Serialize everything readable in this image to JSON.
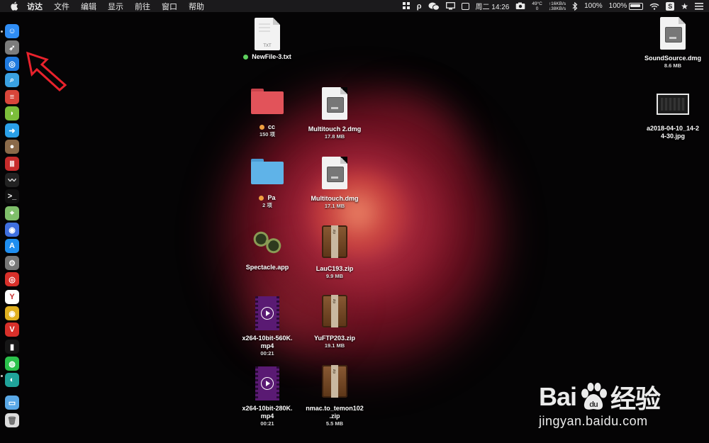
{
  "menubar": {
    "app_name": "访达",
    "menus": [
      "文件",
      "编辑",
      "显示",
      "前往",
      "窗口",
      "帮助"
    ],
    "clock": "周二 14:26",
    "temperature": "49°C",
    "fan": "0",
    "net_up": "↑16KB/s",
    "net_down": "↓38KB/s",
    "volume_percent": "100%",
    "battery_percent": "100%"
  },
  "dock": {
    "items": [
      {
        "name": "finder",
        "color": "#2f8df5",
        "glyph": "☺"
      },
      {
        "name": "launchpad",
        "color": "#7c7c7c",
        "glyph": "➶"
      },
      {
        "name": "safari",
        "color": "#1f7ae0",
        "glyph": "◎"
      },
      {
        "name": "preview",
        "color": "#3aa1e2",
        "glyph": "⌕"
      },
      {
        "name": "app-red",
        "color": "#d9453a",
        "glyph": "≡"
      },
      {
        "name": "android",
        "color": "#7cbe3a",
        "glyph": "◗"
      },
      {
        "name": "migration",
        "color": "#2aa0e8",
        "glyph": "➜"
      },
      {
        "name": "shell",
        "color": "#8a6a4a",
        "glyph": "●"
      },
      {
        "name": "app-bars",
        "color": "#c62b2b",
        "glyph": "Ⅲ"
      },
      {
        "name": "activity-monitor",
        "color": "#222222",
        "glyph": "〰"
      },
      {
        "name": "terminal",
        "color": "#111111",
        "glyph": ">_"
      },
      {
        "name": "maps",
        "color": "#7fbf6a",
        "glyph": "⌖"
      },
      {
        "name": "siri",
        "color": "#3f6fe0",
        "glyph": "◉"
      },
      {
        "name": "app-store",
        "color": "#1f8ef0",
        "glyph": "A"
      },
      {
        "name": "system-preferences",
        "color": "#777777",
        "glyph": "⚙"
      },
      {
        "name": "netease-music",
        "color": "#d8302a",
        "glyph": "◎"
      },
      {
        "name": "yandex",
        "color": "#ffffff",
        "glyph": "Y"
      },
      {
        "name": "chrome",
        "color": "#e0b020",
        "glyph": "◉"
      },
      {
        "name": "vivaldi",
        "color": "#d8302a",
        "glyph": "V"
      },
      {
        "name": "terminal-2",
        "color": "#161616",
        "glyph": "▮"
      },
      {
        "name": "wechat",
        "color": "#2bc14b",
        "glyph": "◍"
      },
      {
        "name": "app-teal",
        "color": "#20a39a",
        "glyph": "◐"
      },
      {
        "name": "downloads-folder",
        "color": "#5aa8e6",
        "glyph": "▭"
      },
      {
        "name": "trash",
        "color": "#dcdcdc",
        "glyph": "🗑"
      }
    ]
  },
  "desktop": {
    "newfile": {
      "name": "NewFile-3.txt",
      "ext": "TXT",
      "tag_color": "#5ed05e"
    },
    "cc_folder": {
      "name": "cc",
      "count": "150 项",
      "tag_color": "#f0a040",
      "color": "#e2535a"
    },
    "pa_folder": {
      "name": "Pa",
      "count": "2 项",
      "tag_color": "#f0a040",
      "color": "#5fb3e8"
    },
    "multitouch2": {
      "name": "Multitouch 2.dmg",
      "size": "17.8 MB"
    },
    "multitouch": {
      "name": "Multitouch.dmg",
      "size": "17.1 MB"
    },
    "spectacle": {
      "name": "Spectacle.app"
    },
    "lauc": {
      "name": "LauC193.zip",
      "size": "9.9 MB"
    },
    "yuftp": {
      "name": "YuFTP203.zip",
      "size": "19.1 MB"
    },
    "nmac": {
      "name_line1": "nmac.to_temon102",
      "name_line2": ".zip",
      "size": "5.5 MB"
    },
    "video560": {
      "name_line1": "x264-10bit-560K.",
      "name_line2": "mp4",
      "duration": "00:21"
    },
    "video280": {
      "name_line1": "x264-10bit-280K.",
      "name_line2": "mp4",
      "duration": "00:21"
    },
    "soundsource": {
      "name": "SoundSource.dmg",
      "size": "8.6 MB"
    },
    "screenshot": {
      "name_line1": "a2018-04-10_14-2",
      "name_line2": "4-30.jpg"
    }
  },
  "watermark": {
    "logo_left": "Bai",
    "logo_right": "经验",
    "url": "jingyan.baidu.com"
  }
}
